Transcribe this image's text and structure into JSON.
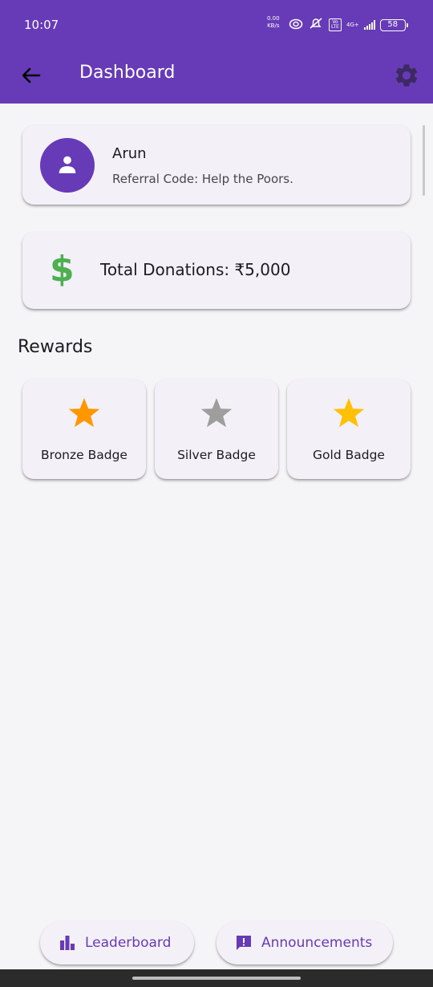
{
  "status_bar": {
    "time": "10:07",
    "speed_value": "0.00",
    "speed_unit": "KB/s",
    "volte_top": "Vo",
    "volte_bottom": "LTE",
    "network": "4G+",
    "battery": "58"
  },
  "app_bar": {
    "title": "Dashboard",
    "back_icon": "arrow-back-icon",
    "settings_icon": "gear-icon"
  },
  "profile": {
    "name": "Arun",
    "referral": "Referral Code: Help the Poors.",
    "avatar_icon": "person-icon"
  },
  "donations": {
    "icon": "$",
    "total": "Total Donations: ₹5,000"
  },
  "rewards": {
    "title": "Rewards",
    "badges": [
      {
        "label": "Bronze Badge",
        "color": "#ff9800"
      },
      {
        "label": "Silver Badge",
        "color": "#9e9e9e"
      },
      {
        "label": "Gold Badge",
        "color": "#ffc107"
      }
    ]
  },
  "bottom_actions": {
    "leaderboard": "Leaderboard",
    "announcements": "Announcements"
  },
  "colors": {
    "primary": "#673ab7",
    "donation_green": "#4caf50",
    "background": "#f5f4f6"
  }
}
